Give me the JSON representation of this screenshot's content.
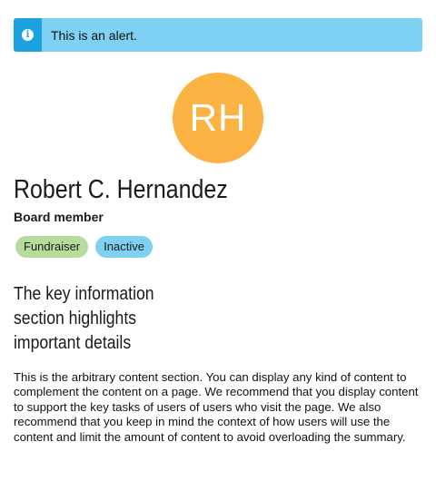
{
  "alert": {
    "icon": "info-icon",
    "text": "This is an alert."
  },
  "profile": {
    "initials": "RH",
    "avatar_color": "#fbb444",
    "name": "Robert C. Hernandez",
    "role": "Board member",
    "badges": [
      {
        "label": "Fundraiser",
        "color": "#b5dc9a"
      },
      {
        "label": "Inactive",
        "color": "#7fd1f4"
      }
    ]
  },
  "key_info": {
    "heading": "The key information section highlights important details"
  },
  "content": {
    "text": "This is the arbitrary content section. You can display any kind of content to complement the content on a page. We recommend that you display content to support the key tasks of users of users who visit the page. We also recommend that you keep in mind the context of how users will use the content and limit the amount of content to avoid overloading the summary."
  },
  "colors": {
    "alert_background": "#7fd1f4",
    "alert_stripe": "#1aa3e0"
  }
}
